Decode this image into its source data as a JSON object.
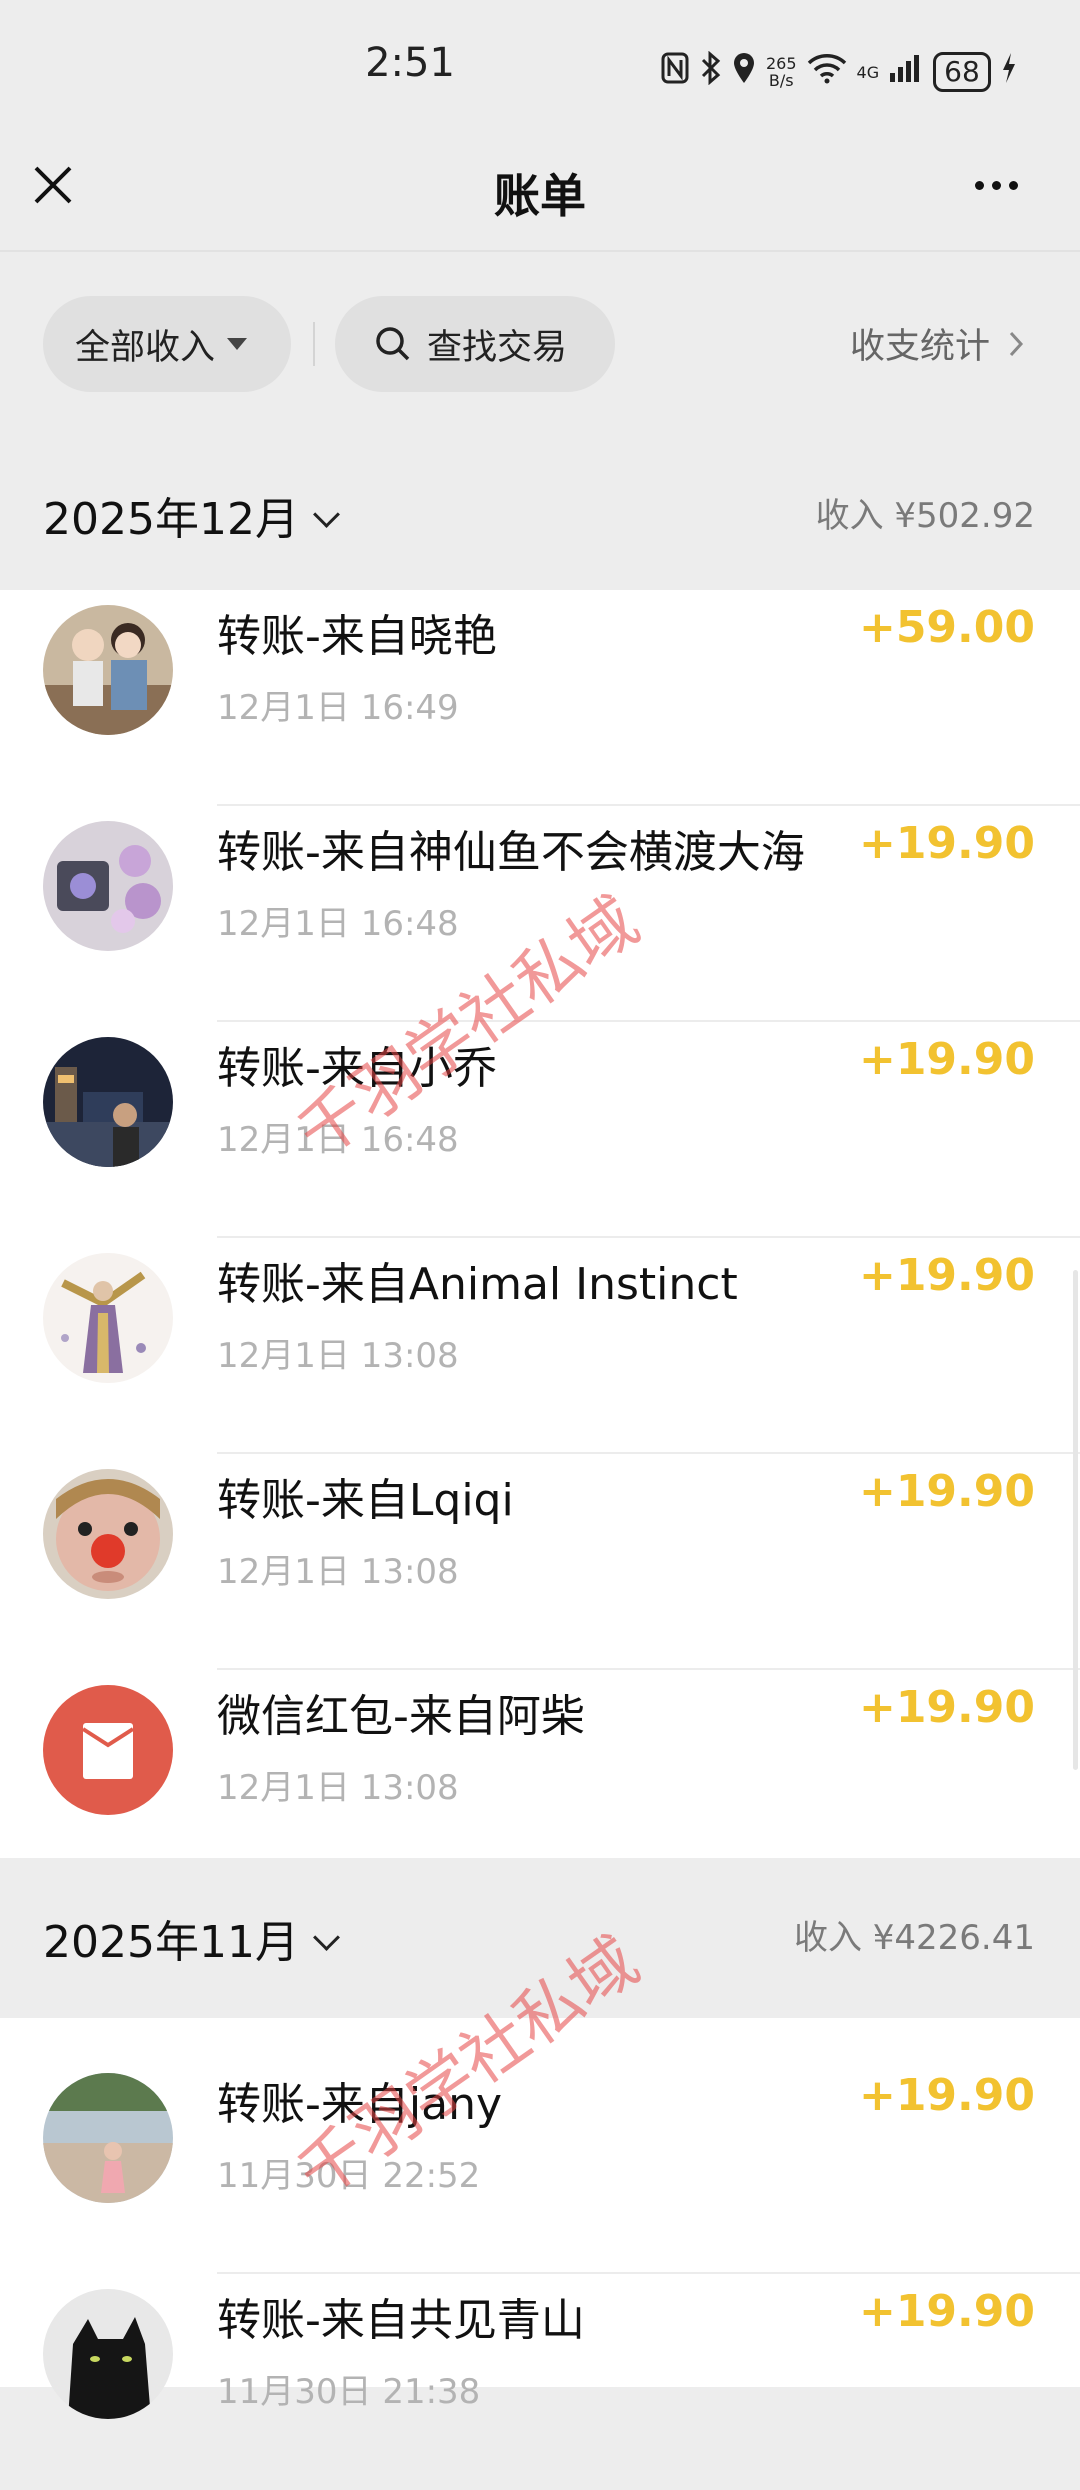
{
  "status_bar": {
    "time": "2:51",
    "net_speed_top": "265",
    "net_speed_bottom": "B/s",
    "network": "4G",
    "battery": "68"
  },
  "nav": {
    "title": "账单"
  },
  "filters": {
    "all_income": "全部收入",
    "search": "查找交易",
    "stats": "收支统计"
  },
  "months": [
    {
      "title": "2025年12月",
      "income": "收入 ¥502.92",
      "items": [
        {
          "title": "转账-来自晓艳",
          "time": "12月1日 16:49",
          "amount": "+59.00",
          "avatar": "photo-family"
        },
        {
          "title": "转账-来自神仙鱼不会横渡大海",
          "time": "12月1日 16:48",
          "amount": "+19.90",
          "avatar": "photo-flowers"
        },
        {
          "title": "转账-来自小乔",
          "time": "12月1日 16:48",
          "amount": "+19.90",
          "avatar": "photo-city-night"
        },
        {
          "title": "转账-来自Animal Instinct",
          "time": "12月1日 13:08",
          "amount": "+19.90",
          "avatar": "illustration-figure"
        },
        {
          "title": "转账-来自Lqiqi",
          "time": "12月1日 13:08",
          "amount": "+19.90",
          "avatar": "cartoon-face"
        },
        {
          "title": "微信红包-来自阿柴",
          "time": "12月1日 13:08",
          "amount": "+19.90",
          "avatar": "red-packet-icon"
        }
      ]
    },
    {
      "title": "2025年11月",
      "income": "收入 ¥4226.41",
      "items": [
        {
          "title": "转账-来自jany",
          "time": "11月30日 22:52",
          "amount": "+19.90",
          "avatar": "photo-beach"
        },
        {
          "title": "转账-来自共见青山",
          "time": "11月30日 21:38",
          "amount": "+19.90",
          "avatar": "photo-black-cat"
        }
      ]
    }
  ],
  "watermark": "千羽学社私域",
  "colors": {
    "amount": "#f2c230",
    "red_packet": "#e05b4b",
    "background": "#ededed"
  }
}
